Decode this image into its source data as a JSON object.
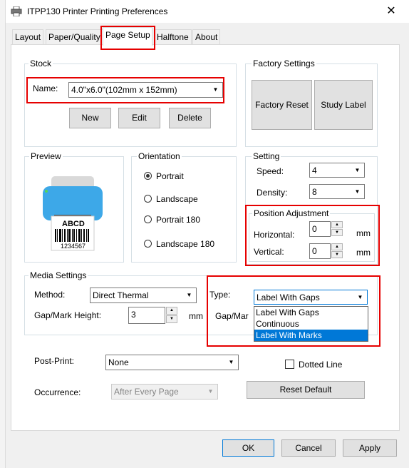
{
  "window": {
    "title": "ITPP130 Printer Printing Preferences"
  },
  "tabs": [
    {
      "label": "Layout"
    },
    {
      "label": "Paper/Quality"
    },
    {
      "label": "Page Setup"
    },
    {
      "label": "Halftone"
    },
    {
      "label": "About"
    }
  ],
  "stock": {
    "label": "Stock",
    "name_label": "Name:",
    "name_value": "4.0\"x6.0\"(102mm x 152mm)",
    "new_btn": "New",
    "edit_btn": "Edit",
    "delete_btn": "Delete"
  },
  "factory": {
    "label": "Factory Settings",
    "reset_btn": "Factory Reset",
    "study_btn": "Study Label"
  },
  "preview": {
    "label": "Preview",
    "label_text": "ABCD",
    "barcode_number": "1234567"
  },
  "orientation": {
    "label": "Orientation",
    "options": [
      "Portrait",
      "Landscape",
      "Portrait 180",
      "Landscape 180"
    ],
    "selected": "Portrait"
  },
  "setting": {
    "label": "Setting",
    "speed_label": "Speed:",
    "speed_value": "4",
    "density_label": "Density:",
    "density_value": "8"
  },
  "position": {
    "label": "Position Adjustment",
    "horizontal_label": "Horizontal:",
    "horizontal_value": "0",
    "vertical_label": "Vertical:",
    "vertical_value": "0",
    "unit": "mm"
  },
  "media": {
    "label": "Media Settings",
    "method_label": "Method:",
    "method_value": "Direct Thermal",
    "type_label": "Type:",
    "type_value": "Label With Gaps",
    "type_options": [
      "Label With Gaps",
      "Continuous",
      "Label With Marks"
    ],
    "type_highlighted": "Label With Marks",
    "gap_height_label": "Gap/Mark Height:",
    "gap_height_value": "3",
    "gap_unit": "mm",
    "gap_offset_label": "Gap/Mar"
  },
  "post_print": {
    "label": "Post-Print:",
    "value": "None",
    "dotted_line_label": "Dotted Line",
    "occurrence_label": "Occurrence:",
    "occurrence_value": "After Every Page",
    "reset_default_btn": "Reset Default"
  },
  "footer": {
    "ok": "OK",
    "cancel": "Cancel",
    "apply": "Apply"
  },
  "colors": {
    "highlight": "#e60000",
    "selection": "#0078d7",
    "printer_blue": "#3da8e8"
  }
}
